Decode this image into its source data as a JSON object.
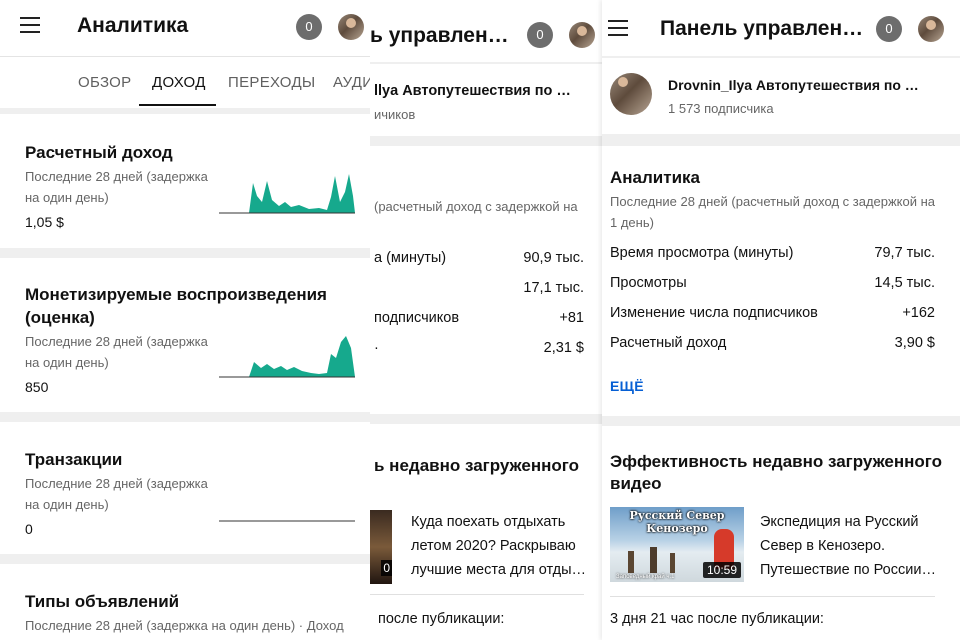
{
  "left_screen": {
    "title": "Аналитика",
    "notifications": "0",
    "tabs": [
      "ОБЗОР",
      "ДОХОД",
      "ПЕРЕХОДЫ",
      "АУДИТ"
    ],
    "active_tab": "ДОХОД",
    "cards": [
      {
        "title": "Расчетный доход",
        "period_line1": "Последние 28 дней (задержка",
        "period_line2": "на один день)",
        "value": "1,05 $"
      },
      {
        "title_line1": "Монетизируемые воспроизведения",
        "title_line2": "(оценка)",
        "period_line1": "Последние 28 дней (задержка",
        "period_line2": "на один день)",
        "value": "850"
      },
      {
        "title": "Транзакции",
        "period_line1": "Последние 28 дней (задержка",
        "period_line2": "на один день)",
        "value": "0"
      },
      {
        "title": "Типы объявлений",
        "period_line1": "Последние 28 дней (задержка на один день) · Доход"
      }
    ]
  },
  "middle_screen": {
    "title": "ь управлен…",
    "notifications": "0",
    "channel_name": "llya Автопутешествия по …",
    "subscribers": "ичиков",
    "period": "(расчетный доход с задержкой на",
    "metrics": [
      {
        "label": "а (минуты)",
        "value": "90,9 тыс."
      },
      {
        "label": "",
        "value": "17,1 тыс."
      },
      {
        "label": "подписчиков",
        "value": "+81"
      },
      {
        "label": "",
        "value": "2,31 $"
      }
    ],
    "section_title": "ь недавно загруженного",
    "video_line1": "Куда поехать отдыхать",
    "video_line2": "летом 2020? Раскрываю",
    "video_line3": "лучшие места для отды…",
    "duration_fragment": "0",
    "after_publication": "после публикации:"
  },
  "right_screen": {
    "title": "Панель управлен…",
    "notifications": "0",
    "channel_name": "Drovnin_Ilya Автопутешествия по …",
    "subscribers": "1 573 подписчика",
    "analytics_title": "Аналитика",
    "period_line1": "Последние 28 дней (расчетный доход с задержкой на",
    "period_line2": "1 день)",
    "metrics": [
      {
        "label": "Время просмотра (минуты)",
        "value": "79,7 тыс."
      },
      {
        "label": "Просмотры",
        "value": "14,5 тыс."
      },
      {
        "label": "Изменение числа подписчиков",
        "value": "+162"
      },
      {
        "label": "Расчетный доход",
        "value": "3,90 $"
      }
    ],
    "more": "ЕЩЁ",
    "section_title_line1": "Эффективность недавно загруженного",
    "section_title_line2": "видео",
    "thumb_text_line1": "Русский Север",
    "thumb_text_line2": "Кенозеро",
    "thumb_caption": "Заповедный край ч.1",
    "duration": "10:59",
    "video_line1": "Экспедиция на Русский",
    "video_line2": "Север в Кенозеро.",
    "video_line3": "Путешествие по России…",
    "after_publication": "3 дня 21 час после публикации:"
  },
  "colors": {
    "sparkline": "#16a98d",
    "link": "#065fd4",
    "badge": "#6d6d6d"
  }
}
